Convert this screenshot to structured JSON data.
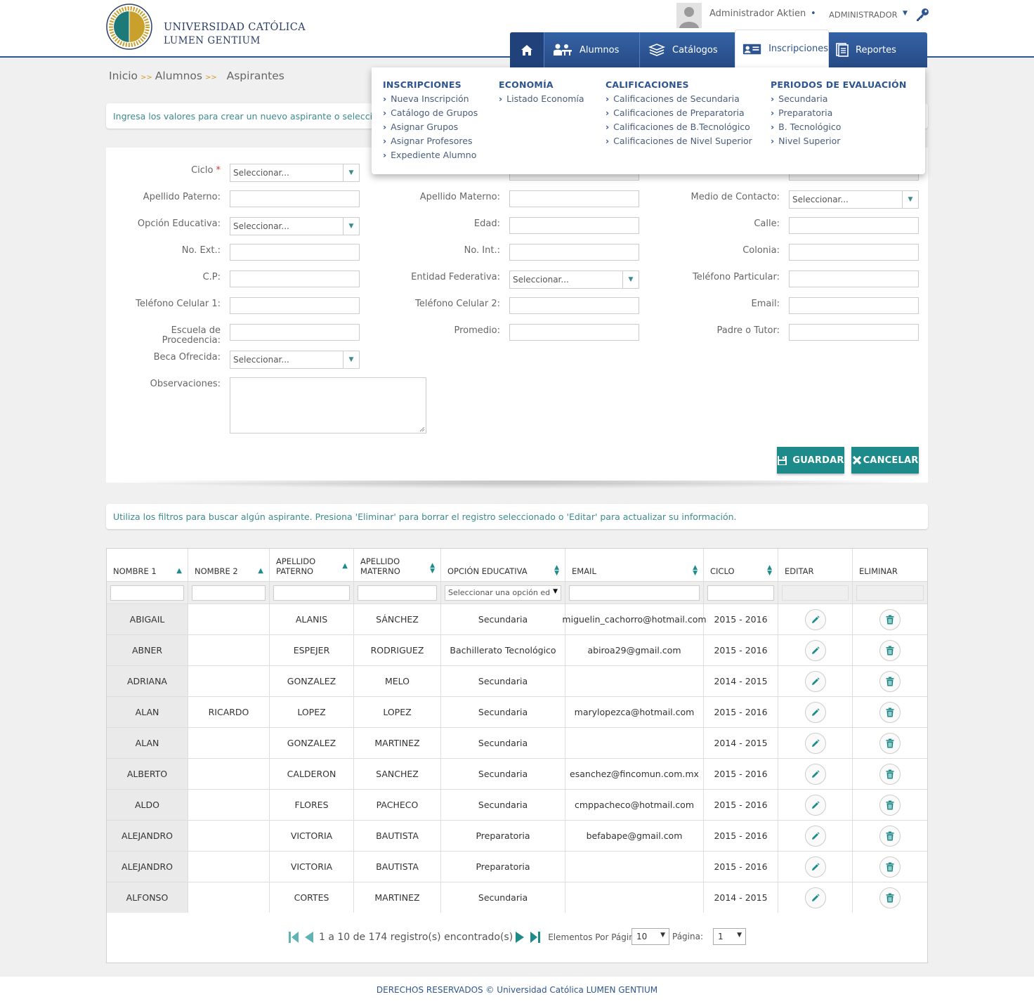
{
  "header": {
    "logo_line1": "UNIVERSIDAD CATÓLICA",
    "logo_line2": "LUMEN GENTIUM",
    "user_name": "Administrador Aktien",
    "role": "ADMINISTRADOR"
  },
  "nav": {
    "items": [
      {
        "label": "Alumnos"
      },
      {
        "label": "Catálogos"
      },
      {
        "label": "Inscripciones"
      },
      {
        "label": "Reportes"
      }
    ]
  },
  "dropdown": {
    "columns": [
      {
        "heading": "INSCRIPCIONES",
        "links": [
          "Nueva Inscripción",
          "Catálogo de Grupos",
          "Asignar Grupos",
          "Asignar Profesores",
          "Expediente Alumno"
        ]
      },
      {
        "heading": "ECONOMÍA",
        "links": [
          "Listado Economía"
        ]
      },
      {
        "heading": "CALIFICACIONES",
        "links": [
          "Calificaciones de Secundaria",
          "Calificaciones de Preparatoria",
          "Calificaciones de B.Tecnológico",
          "Calificaciones de Nivel Superior"
        ]
      },
      {
        "heading": "PERIODOS DE EVALUACIÓN",
        "links": [
          "Secundaria",
          "Preparatoria",
          "B. Tecnológico",
          "Nivel Superior"
        ]
      }
    ]
  },
  "breadcrumb": {
    "items": [
      "Inicio",
      "Alumnos",
      "Aspirantes"
    ]
  },
  "info_top": "Ingresa los valores para crear un nuevo aspirante o seleccio",
  "form": {
    "select_placeholder": "Seleccionar...",
    "labels": {
      "ciclo": "Ciclo",
      "apellido_paterno": "Apellido Paterno:",
      "apellido_materno": "Apellido Materno:",
      "medio_contacto": "Medio de Contacto:",
      "opcion_educativa": "Opción Educativa:",
      "edad": "Edad:",
      "calle": "Calle:",
      "no_ext": "No. Ext.:",
      "no_int": "No. Int.:",
      "colonia": "Colonia:",
      "cp": "C.P:",
      "entidad": "Entidad Federativa:",
      "tel_particular": "Teléfono Particular:",
      "tel_cel1": "Teléfono Celular 1:",
      "tel_cel2": "Teléfono Celular 2:",
      "email": "Email:",
      "escuela_1": "Escuela de",
      "escuela_2": "Procedencia:",
      "promedio": "Promedio:",
      "padre": "Padre o Tutor:",
      "beca": "Beca Ofrecida:",
      "observaciones": "Observaciones:"
    },
    "save_label": "GUARDAR",
    "cancel_label": "CANCELAR"
  },
  "info_bottom": "Utiliza los filtros para buscar algún aspirante. Presiona 'Eliminar' para borrar el registro seleccionado o 'Editar' para actualizar su información.",
  "table": {
    "headers": [
      "NOMBRE 1",
      "NOMBRE 2",
      "APELLIDO PATERNO",
      "APELLIDO MATERNO",
      "OPCIÓN EDUCATIVA",
      "EMAIL",
      "CICLO",
      "EDITAR",
      "ELIMINAR"
    ],
    "header_lines": {
      "h2a": "APELLIDO",
      "h2b": "PATERNO",
      "h3a": "APELLIDO",
      "h3b": "MATERNO"
    },
    "filter_select_placeholder": "Seleccionar una opción ed",
    "rows": [
      [
        "ABIGAIL",
        "",
        "ALANIS",
        "SÁNCHEZ",
        "Secundaria",
        "miguelin_cachorro@hotmail.com",
        "2015 - 2016"
      ],
      [
        "ABNER",
        "",
        "ESPEJER",
        "RODRIGUEZ",
        "Bachillerato Tecnológico",
        "abiroa29@gmail.com",
        "2015 - 2016"
      ],
      [
        "ADRIANA",
        "",
        "GONZALEZ",
        "MELO",
        "Secundaria",
        "",
        "2014 - 2015"
      ],
      [
        "ALAN",
        "RICARDO",
        "LOPEZ",
        "LOPEZ",
        "Secundaria",
        "marylopezca@hotmail.com",
        "2015 - 2016"
      ],
      [
        "ALAN",
        "",
        "GONZALEZ",
        "MARTINEZ",
        "Secundaria",
        "",
        "2014 - 2015"
      ],
      [
        "ALBERTO",
        "",
        "CALDERON",
        "SANCHEZ",
        "Secundaria",
        "esanchez@fincomun.com.mx",
        "2015 - 2016"
      ],
      [
        "ALDO",
        "",
        "FLORES",
        "PACHECO",
        "Secundaria",
        "cmppacheco@hotmail.com",
        "2015 - 2016"
      ],
      [
        "ALEJANDRO",
        "",
        "VICTORIA",
        "BAUTISTA",
        "Preparatoria",
        "befabape@gmail.com",
        "2015 - 2016"
      ],
      [
        "ALEJANDRO",
        "",
        "VICTORIA",
        "BAUTISTA",
        "Preparatoria",
        "",
        "2015 - 2016"
      ],
      [
        "ALFONSO",
        "",
        "CORTES",
        "MARTINEZ",
        "Secundaria",
        "",
        "2014 - 2015"
      ]
    ]
  },
  "pager": {
    "summary": "1 a 10 de 174 registro(s) encontrado(s)",
    "per_page_label": "Elementos Por Página:",
    "per_page_value": "10",
    "page_label": "Página:",
    "page_value": "1"
  },
  "footer": "DERECHOS RESERVADOS © Universidad Católica LUMEN GENTIUM",
  "colors": {
    "brand_blue": "#2e5590",
    "teal": "#1d8b8a",
    "gold": "#d39b2b"
  },
  "icons": [
    "home-icon",
    "students-icon",
    "catalog-icon",
    "id-card-icon",
    "report-icon",
    "key-icon",
    "pencil-icon",
    "trash-icon",
    "save-icon",
    "close-icon",
    "first-page-icon",
    "prev-page-icon",
    "next-page-icon",
    "last-page-icon"
  ]
}
